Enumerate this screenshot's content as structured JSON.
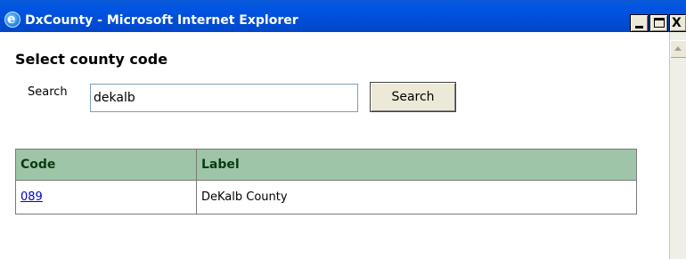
{
  "window": {
    "title": "DxCounty - Microsoft Internet Explorer",
    "icon": "ie-icon",
    "buttons": {
      "minimize": "_",
      "maximize": "□",
      "close": "X"
    }
  },
  "page": {
    "heading": "Select county code",
    "search": {
      "label": "Search",
      "value": "dekalb",
      "placeholder": "",
      "button_label": "Search"
    },
    "table": {
      "columns": [
        "Code",
        "Label"
      ],
      "rows": [
        {
          "code": "089",
          "label": "DeKalb County"
        }
      ],
      "header_color": "#9fc5a9"
    }
  }
}
